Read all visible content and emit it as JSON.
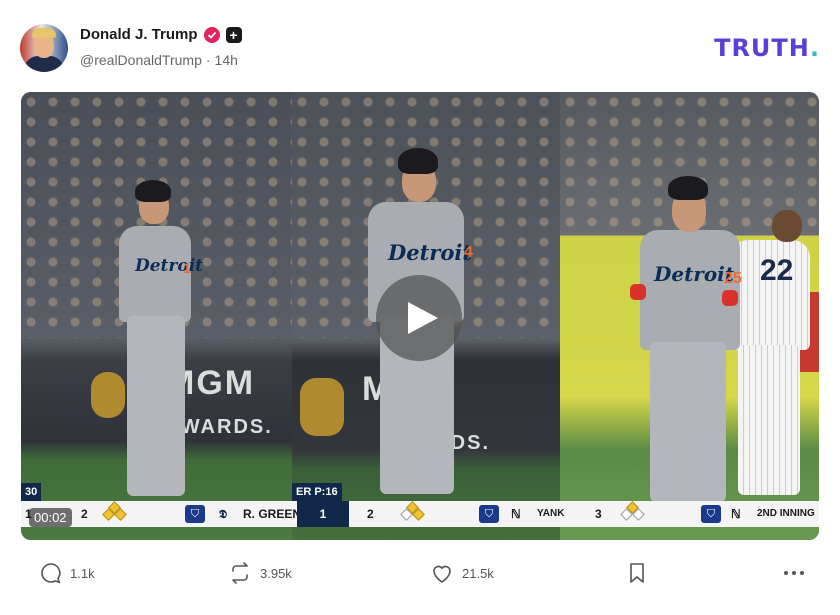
{
  "post": {
    "author_name": "Donald J. Trump",
    "handle": "@realDonaldTrump",
    "separator": "·",
    "time": "14h",
    "brand": "TRUTH",
    "brand_dot": "."
  },
  "video": {
    "timestamp": "00:02",
    "play_icon": "play-icon",
    "panels": [
      {
        "jersey": "Detroit",
        "jersey_number": "1",
        "sign_line1": "MGM",
        "sign_line2": "REWARDS.",
        "score_corner": "30",
        "score_left": "1",
        "score_count": "2",
        "score_team": "R. GREEN",
        "score_right": "1"
      },
      {
        "jersey": "Detroit",
        "jersey_number": "4",
        "sign_line1": "M",
        "sign_line2": "WARDS.",
        "score_corner": "ER P:16",
        "score_count": "2",
        "score_team": "YANK"
      },
      {
        "jersey": "Detroit",
        "jersey_number": "25",
        "opponent_number": "22",
        "score_count": "3",
        "score_team": "2ND INNING"
      }
    ]
  },
  "actions": {
    "replies": "1.1k",
    "retruths": "3.95k",
    "likes": "21.5k"
  },
  "colors": {
    "brand": "#5b3fd6",
    "brand_accent": "#33c0c0",
    "verified": "#e0245e"
  }
}
